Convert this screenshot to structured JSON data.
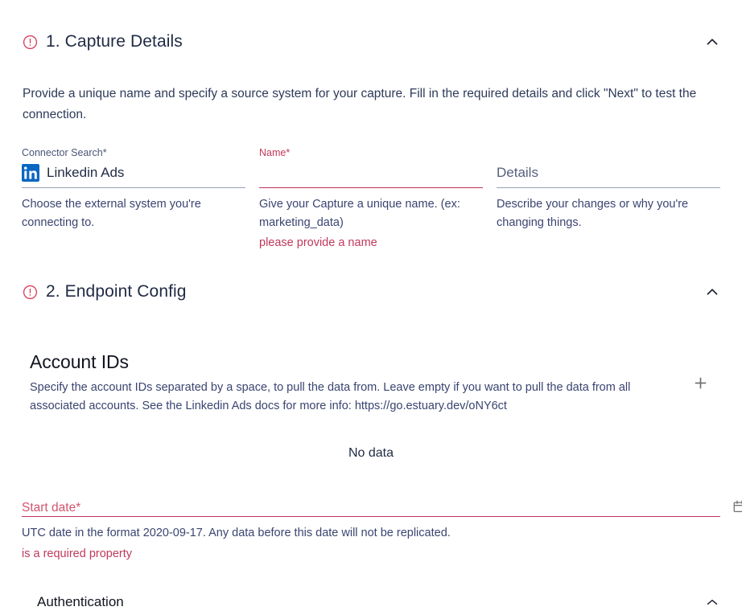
{
  "colors": {
    "accent_red": "#c0325a",
    "error_text": "#c0395c",
    "body_text": "#2e3a59",
    "heading": "#1f2a44",
    "linkedin_blue": "#0a66c2",
    "divider": "#9aa0b5"
  },
  "section_capture": {
    "status_icon": "alert-circle-icon",
    "title": "1. Capture Details",
    "toggle_icon": "chevron-up-icon",
    "description": "Provide a unique name and specify a source system for your capture. Fill in the required details and click \"Next\" to test the connection.",
    "fields": [
      {
        "label": "Connector Search",
        "required_marker": "*",
        "value": "Linkedin Ads",
        "icon": "linkedin-icon",
        "help": "Choose the external system you're connecting to.",
        "error": "",
        "state": "normal"
      },
      {
        "label": "Name",
        "required_marker": "*",
        "value": "",
        "placeholder": "",
        "help": "Give your Capture a unique name. (ex: marketing_data)",
        "error": "please provide a name",
        "state": "error"
      },
      {
        "label": "",
        "required_marker": "",
        "value": "",
        "placeholder": "Details",
        "help": "Describe your changes or why you're changing things.",
        "error": "",
        "state": "normal"
      }
    ]
  },
  "section_endpoint": {
    "status_icon": "alert-circle-icon",
    "title": "2. Endpoint Config",
    "toggle_icon": "chevron-up-icon",
    "account_ids": {
      "title": "Account IDs",
      "description": "Specify the account IDs separated by a space, to pull the data from. Leave empty if you want to pull the data from all associated accounts. See the Linkedin Ads docs for more info: https://go.estuary.dev/oNY6ct",
      "add_icon": "plus-icon",
      "empty_state": "No data"
    },
    "start_date": {
      "label": "Start date",
      "required_marker": "*",
      "value": "",
      "calendar_icon": "calendar-icon",
      "help": "UTC date in the format 2020-09-17. Any data before this date will not be replicated.",
      "error": "is a required property"
    },
    "authentication": {
      "title": "Authentication",
      "toggle_icon": "chevron-up-icon"
    }
  }
}
